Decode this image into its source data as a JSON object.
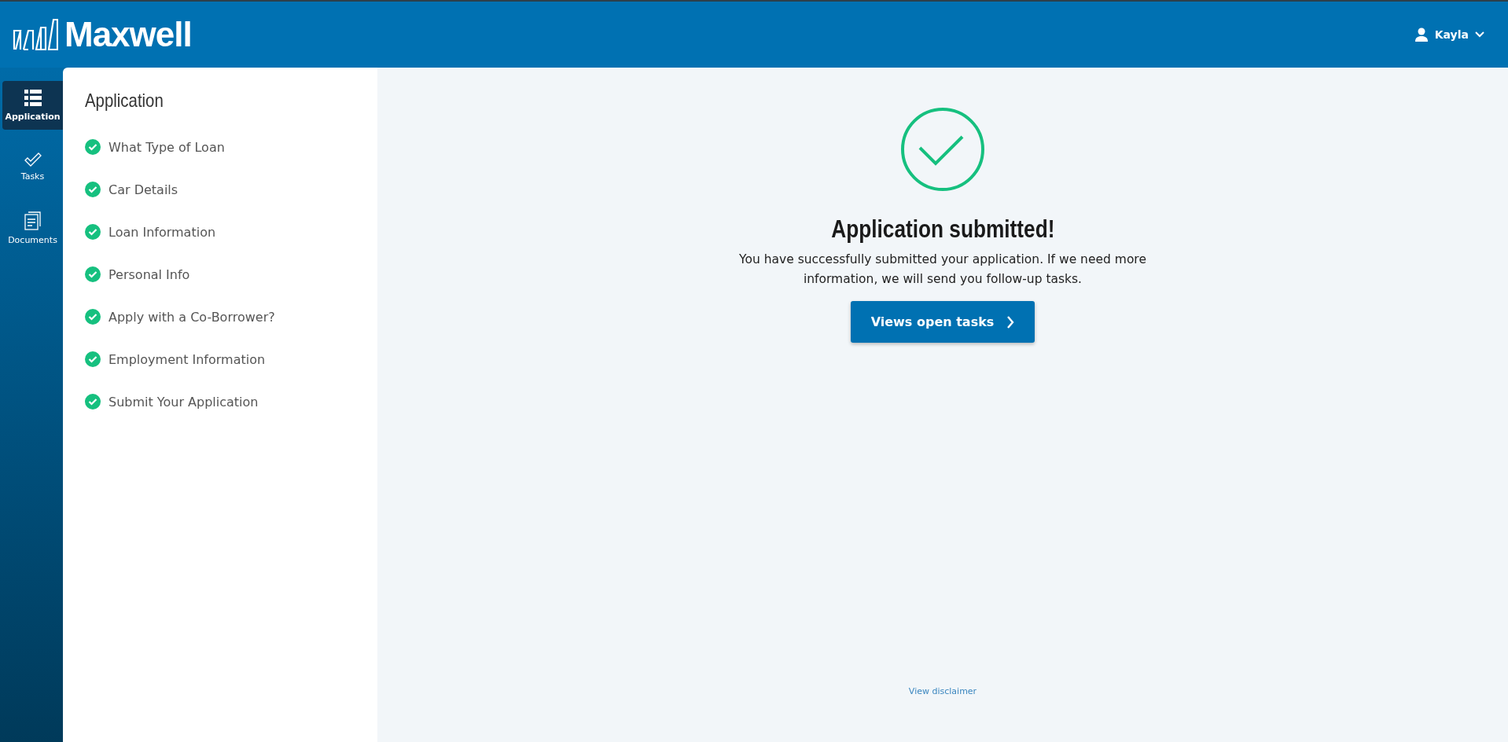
{
  "header": {
    "logo": "Maxwell",
    "user": "Kayla"
  },
  "nav": [
    {
      "label": "Application",
      "kind": "list",
      "selected": true
    },
    {
      "label": "Tasks",
      "kind": "check",
      "selected": false
    },
    {
      "label": "Documents",
      "kind": "document",
      "selected": false
    }
  ],
  "steps": {
    "title": "Application",
    "items": [
      {
        "label": "What Type of Loan",
        "completed": true
      },
      {
        "label": "Car Details",
        "completed": true
      },
      {
        "label": "Loan Information",
        "completed": true
      },
      {
        "label": "Personal Info",
        "completed": true
      },
      {
        "label": "Apply with a Co-Borrower?",
        "completed": true
      },
      {
        "label": "Employment Information",
        "completed": true
      },
      {
        "label": "Submit Your Application",
        "completed": true
      }
    ]
  },
  "confirmation": {
    "heading": "Application submitted!",
    "message": "You have successfully submitted your application. If we need more information, we will send you follow-up tasks.",
    "button": "Views open tasks"
  },
  "footer": {
    "link": "View disclaimer"
  }
}
